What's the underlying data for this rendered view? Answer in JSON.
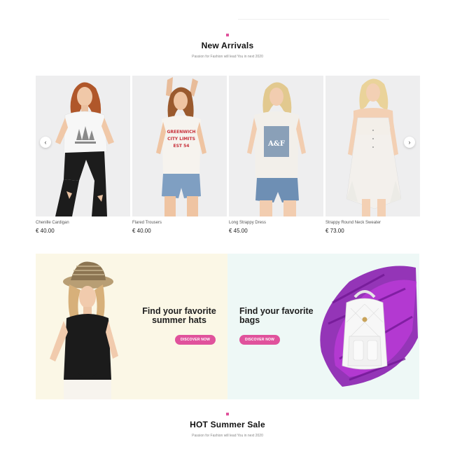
{
  "new_arrivals": {
    "title": "New Arrivals",
    "subtitle": "Passion for Fashion will lead You in next 2020"
  },
  "products": [
    {
      "name": "Chenille Cardigan",
      "price": "€ 40.00",
      "shirt_print": "adidas"
    },
    {
      "name": "Flared Trousers",
      "price": "€ 40.00",
      "shirt_print": "GREENWICH CITY LIMITS EST 54"
    },
    {
      "name": "Long Strappy Dress",
      "price": "€ 45.00",
      "shirt_print": "A&F"
    },
    {
      "name": "Strappy Round Neck Sweater",
      "price": "€ 73.00",
      "shirt_print": ""
    }
  ],
  "carousel": {
    "prev_icon": "chevron-left-icon",
    "next_icon": "chevron-right-icon"
  },
  "banners": {
    "hats": {
      "title_line1": "Find your favorite",
      "title_line2": "summer hats",
      "button": "DISCOVER NOW"
    },
    "bags": {
      "title_line1": "Find your favorite",
      "title_line2": "bags",
      "button": "DISCOVER NOW"
    }
  },
  "hot_sale": {
    "title": "HOT Summer Sale",
    "subtitle": "Passion for Fashion will lead You in next 2020"
  },
  "colors": {
    "accent": "#e0529c",
    "hats_bg": "#fbf7e6",
    "bags_bg": "#eef8f6",
    "photo_bg": "#eeeeef"
  }
}
